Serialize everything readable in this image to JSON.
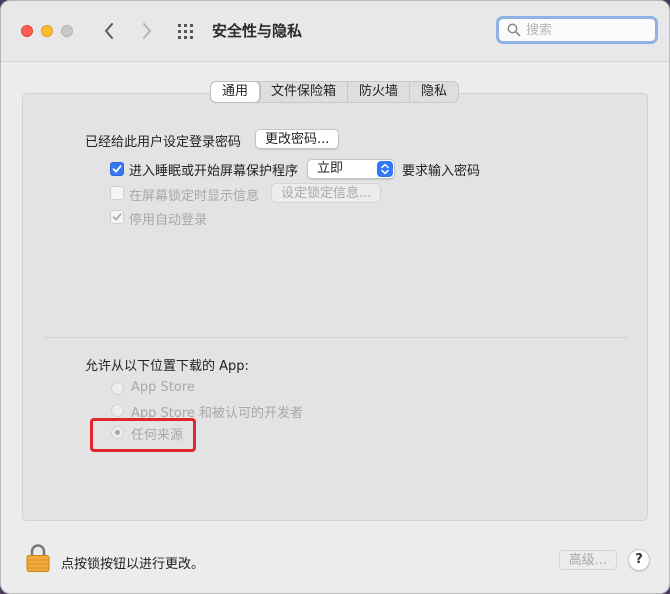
{
  "window": {
    "title": "安全性与隐私",
    "search_placeholder": "搜索"
  },
  "tabs": [
    {
      "label": "通用",
      "active": true
    },
    {
      "label": "文件保险箱",
      "active": false
    },
    {
      "label": "防火墙",
      "active": false
    },
    {
      "label": "隐私",
      "active": false
    }
  ],
  "general": {
    "login_password_label": "已经给此用户设定登录密码",
    "change_password_button": "更改密码...",
    "require_password": {
      "checked": true,
      "label": "进入睡眠或开始屏幕保护程序",
      "select_value": "立即",
      "suffix": "要求输入密码"
    },
    "show_message": {
      "checked": false,
      "enabled": false,
      "label": "在屏幕锁定时显示信息",
      "button": "设定锁定信息..."
    },
    "disable_autologin": {
      "checked": true,
      "enabled": false,
      "label": "停用自动登录"
    }
  },
  "downloads": {
    "heading": "允许从以下位置下载的 App:",
    "options": [
      {
        "label": "App Store",
        "selected": false
      },
      {
        "label": "App Store 和被认可的开发者",
        "selected": false
      },
      {
        "label": "任何来源",
        "selected": true
      }
    ]
  },
  "footer": {
    "lock_text": "点按锁按钮以进行更改。",
    "advanced_button": "高级...",
    "help_button": "?"
  },
  "colors": {
    "accent": "#3478f6",
    "highlight": "#e0262a",
    "lock": "#f2a93b"
  }
}
